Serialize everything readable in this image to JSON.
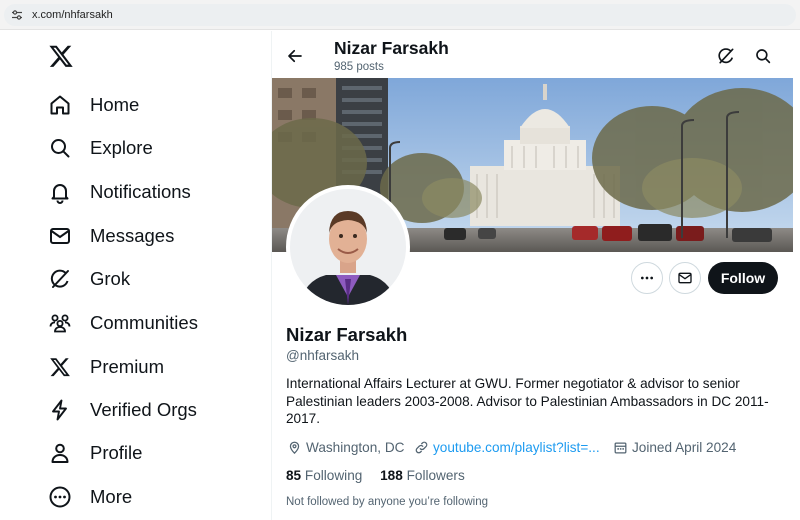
{
  "browser": {
    "url": "x.com/nhfarsakh"
  },
  "sidebar": {
    "items": [
      {
        "label": "Home",
        "icon": "home-icon"
      },
      {
        "label": "Explore",
        "icon": "search-icon"
      },
      {
        "label": "Notifications",
        "icon": "bell-icon"
      },
      {
        "label": "Messages",
        "icon": "mail-icon"
      },
      {
        "label": "Grok",
        "icon": "grok-icon"
      },
      {
        "label": "Communities",
        "icon": "communities-icon"
      },
      {
        "label": "Premium",
        "icon": "x-logo-icon"
      },
      {
        "label": "Verified Orgs",
        "icon": "lightning-icon"
      },
      {
        "label": "Profile",
        "icon": "person-icon"
      },
      {
        "label": "More",
        "icon": "more-circle-icon"
      }
    ]
  },
  "header": {
    "name": "Nizar Farsakh",
    "posts": "985 posts"
  },
  "actions": {
    "follow_label": "Follow"
  },
  "profile": {
    "name": "Nizar Farsakh",
    "handle": "@nhfarsakh",
    "bio": "International Affairs Lecturer at GWU. Former negotiator & advisor to senior Palestinian leaders 2003-2008. Advisor to Palestinian Ambassadors in DC 2011-2017.",
    "location": "Washington, DC",
    "website": "youtube.com/playlist?list=...",
    "joined": "Joined April 2024",
    "following_count": "85",
    "following_label": "Following",
    "followers_count": "188",
    "followers_label": "Followers",
    "not_followed": "Not followed by anyone you’re following"
  },
  "colors": {
    "accent": "#1d9bf0",
    "text": "#0f1419",
    "muted": "#536471",
    "button_dark": "#0f1419"
  }
}
